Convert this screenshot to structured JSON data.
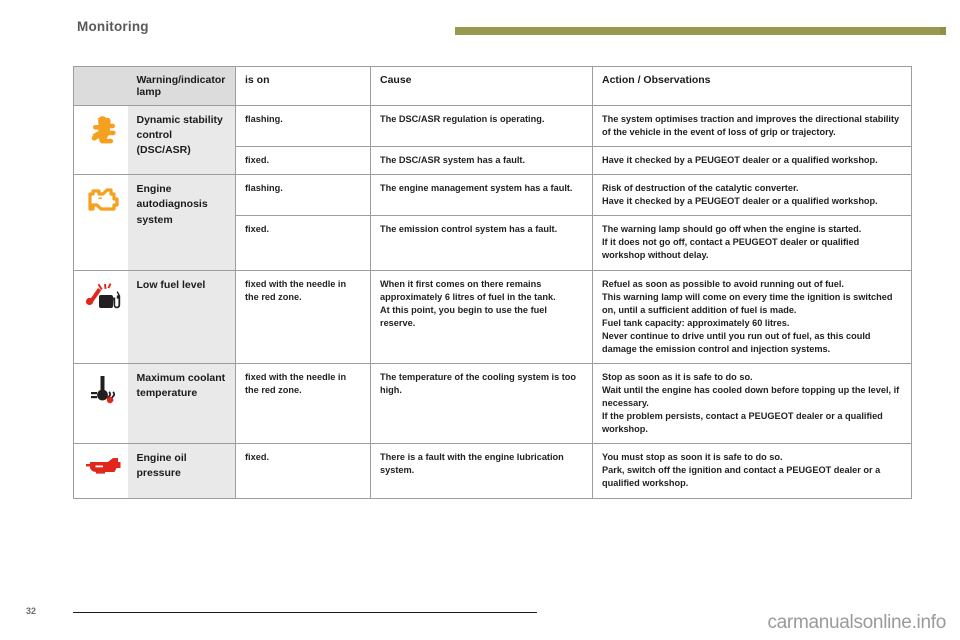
{
  "header": {
    "title": "Monitoring",
    "accent_color": "#96994e"
  },
  "table": {
    "columns": [
      "Warning/indicator lamp",
      "is on",
      "Cause",
      "Action / Observations"
    ],
    "rows": [
      {
        "icon": "dsc-asr-skidding-car-icon",
        "icon_color": "#F5A01E",
        "lamp": "Dynamic stability control (DSC/ASR)",
        "is_on": "flashing.",
        "cause": "The DSC/ASR regulation is operating.",
        "action": "The system optimises traction and improves the directional stability of the vehicle in the event of loss of grip or trajectory."
      },
      {
        "icon": "",
        "icon_color": "",
        "lamp": "",
        "is_on": "fixed.",
        "cause": "The DSC/ASR system has a fault.",
        "action": "Have it checked by a PEUGEOT dealer or a qualified workshop."
      },
      {
        "icon": "engine-check-icon",
        "icon_color": "#F5A01E",
        "lamp": "Engine autodiagnosis system",
        "is_on": "flashing.",
        "cause": "The engine management system has a fault.",
        "action": "Risk of destruction of the catalytic converter.\nHave it checked by a PEUGEOT dealer or a qualified workshop."
      },
      {
        "icon": "",
        "icon_color": "",
        "lamp": "",
        "is_on": "fixed.",
        "cause": "The emission control system has a fault.",
        "action": "The warning lamp should go off when the engine is started.\nIf it does not go off, contact a PEUGEOT dealer or qualified workshop without delay."
      },
      {
        "icon": "fuel-pump-low-icon",
        "icon_color": "#E1261C",
        "lamp": "Low fuel level",
        "is_on": "fixed with the needle in the red zone.",
        "cause": "When it first comes on there remains approximately 6 litres of fuel in the tank.\nAt this point, you begin to use the fuel reserve.",
        "action": "Refuel as soon as possible to avoid running out of fuel.\nThis warning lamp will come on every time the ignition is switched on, until a sufficient addition of fuel is made.\nFuel tank capacity: approximately 60 litres.\nNever continue to drive until you run out of fuel, as this could damage the emission control and injection systems."
      },
      {
        "icon": "coolant-temperature-icon",
        "icon_color": "#E1261C",
        "lamp": "Maximum coolant temperature",
        "is_on": "fixed with the needle in the red zone.",
        "cause": "The temperature of the cooling system is too high.",
        "action": "Stop as soon as it is safe to do so.\nWait until the engine has cooled down before topping up the level, if necessary.\nIf the problem persists, contact a PEUGEOT dealer or a qualified workshop."
      },
      {
        "icon": "oil-can-icon",
        "icon_color": "#E1261C",
        "lamp": "Engine oil pressure",
        "is_on": "fixed.",
        "cause": "There is a fault with the engine lubrication system.",
        "action": "You must stop as soon it is safe to do so.\nPark, switch off the ignition and contact a PEUGEOT dealer or a qualified workshop."
      }
    ]
  },
  "footer": {
    "page_number": "32",
    "watermark": "carmanualsonline.info"
  }
}
